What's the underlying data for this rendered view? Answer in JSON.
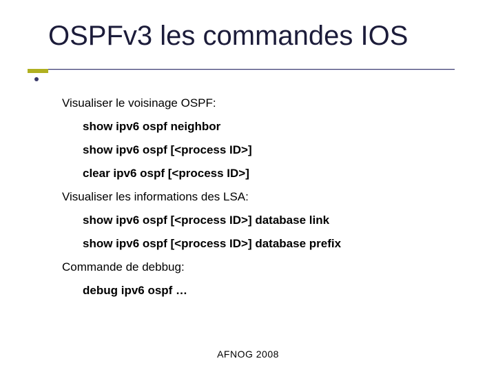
{
  "title": {
    "part1": "OSPFv3",
    "part2": "les commandes IOS"
  },
  "sections": [
    {
      "heading": "Visualiser le voisinage OSPF:",
      "commands": [
        "show ipv6 ospf neighbor",
        "show ipv6 ospf [<process ID>]",
        "clear ipv6 ospf [<process ID>]"
      ]
    },
    {
      "heading": "Visualiser les informations des LSA:",
      "commands": [
        "show ipv6 ospf [<process ID>] database link",
        "show ipv6 ospf [<process ID>] database prefix"
      ]
    },
    {
      "heading": "Commande de debbug:",
      "commands": [
        "debug ipv6 ospf …"
      ]
    }
  ],
  "footer": "AFNOG 2008"
}
